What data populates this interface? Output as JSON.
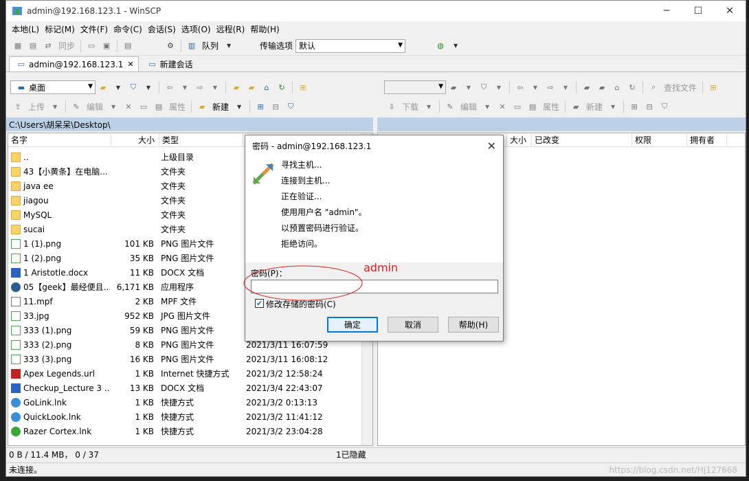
{
  "window": {
    "title": "admin@192.168.123.1 - WinSCP"
  },
  "menu": [
    "本地(L)",
    "标记(M)",
    "文件(F)",
    "命令(C)",
    "会话(S)",
    "选项(O)",
    "远程(R)",
    "帮助(H)"
  ],
  "toolbar1": {
    "sync": "同步",
    "queue": "队列",
    "transfer_label": "传输选项",
    "transfer_value": "默认"
  },
  "tabs": {
    "session": "admin@192.168.123.1",
    "new_session": "新建会话"
  },
  "local": {
    "location": "桌面",
    "upload": "上传",
    "edit": "编辑",
    "properties": "属性",
    "new": "新建",
    "path": "C:\\Users\\胡呆呆\\Desktop\\",
    "columns": {
      "name": "名字",
      "size": "大小",
      "type": "类型"
    },
    "files": [
      {
        "name": "..",
        "size": "",
        "type": "上级目录",
        "date": "",
        "icon": "up"
      },
      {
        "name": "43【小黄条】在电脑...",
        "size": "",
        "type": "文件夹",
        "date": "",
        "icon": "folder"
      },
      {
        "name": "java ee",
        "size": "",
        "type": "文件夹",
        "date": "",
        "icon": "folder"
      },
      {
        "name": "jiagou",
        "size": "",
        "type": "文件夹",
        "date": "",
        "icon": "folder"
      },
      {
        "name": "MySQL",
        "size": "",
        "type": "文件夹",
        "date": "",
        "icon": "folder"
      },
      {
        "name": "sucai",
        "size": "",
        "type": "文件夹",
        "date": "",
        "icon": "folder"
      },
      {
        "name": "1 (1).png",
        "size": "101 KB",
        "type": "PNG 图片文件",
        "date": "",
        "icon": "png"
      },
      {
        "name": "1 (2).png",
        "size": "35 KB",
        "type": "PNG 图片文件",
        "date": "",
        "icon": "png"
      },
      {
        "name": "1 Aristotle.docx",
        "size": "11 KB",
        "type": "DOCX 文档",
        "date": "",
        "icon": "doc"
      },
      {
        "name": "05【geek】最经便且...",
        "size": "6,171 KB",
        "type": "应用程序",
        "date": "",
        "icon": "exe"
      },
      {
        "name": "11.mpf",
        "size": "2 KB",
        "type": "MPF 文件",
        "date": "",
        "icon": "file"
      },
      {
        "name": "33.jpg",
        "size": "952 KB",
        "type": "JPG 图片文件",
        "date": "",
        "icon": "png"
      },
      {
        "name": "333 (1).png",
        "size": "59 KB",
        "type": "PNG 图片文件",
        "date": "",
        "icon": "png"
      },
      {
        "name": "333 (2).png",
        "size": "8 KB",
        "type": "PNG 图片文件",
        "date": "2021/3/11   16:07:59",
        "icon": "png"
      },
      {
        "name": "333 (3).png",
        "size": "16 KB",
        "type": "PNG 图片文件",
        "date": "2021/3/11   16:08:12",
        "icon": "png"
      },
      {
        "name": "Apex Legends.url",
        "size": "1 KB",
        "type": "Internet 快捷方式",
        "date": "2021/3/2   12:58:24",
        "icon": "red"
      },
      {
        "name": "Checkup_Lecture 3 ...",
        "size": "13 KB",
        "type": "DOCX 文档",
        "date": "2021/3/4   22:43:07",
        "icon": "doc"
      },
      {
        "name": "GoLink.lnk",
        "size": "1 KB",
        "type": "快捷方式",
        "date": "2021/3/2   0:13:13",
        "icon": "lnk"
      },
      {
        "name": "QuickLook.lnk",
        "size": "1 KB",
        "type": "快捷方式",
        "date": "2021/3/2   11:41:12",
        "icon": "lnk"
      },
      {
        "name": "Razer Cortex.lnk",
        "size": "1 KB",
        "type": "快捷方式",
        "date": "2021/3/2   23:04:28",
        "icon": "green"
      }
    ]
  },
  "remote": {
    "download": "下载",
    "edit": "编辑",
    "properties": "属性",
    "new": "新建",
    "find": "查找文件",
    "columns": {
      "size": "大小",
      "changed": "已改变",
      "rights": "权限",
      "owner": "拥有者"
    }
  },
  "status": {
    "selection": "0 B / 11.4 MB，   0 / 37",
    "hidden": "1已隐藏",
    "connection": "未连接。"
  },
  "dialog": {
    "title": "密码 - admin@192.168.123.1",
    "messages": [
      "寻找主机...",
      "连接到主机...",
      "正在验证...",
      "使用用户名 \"admin\"。",
      "以预置密码进行验证。",
      "拒绝访问。"
    ],
    "password_label": "密码(P)：",
    "password_value": "",
    "checkbox_label": "修改存储的密码(C)",
    "ok": "确定",
    "cancel": "取消",
    "help": "帮助(H)",
    "annotation": "admin"
  },
  "watermark": "https://blog.csdn.net/Hj127668"
}
